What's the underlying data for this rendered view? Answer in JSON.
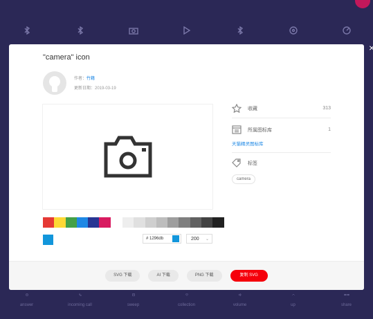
{
  "modal": {
    "title": "\"camera\" icon",
    "author_prefix": "作者：",
    "author_name": "竹籍",
    "updated_label": "更新日期：2019-03-19",
    "palette_colors": [
      "#e53935",
      "#fdd835",
      "#43a047",
      "#1e88e5",
      "#283593",
      "#d81b60"
    ],
    "gray_colors": [
      "#eeeeee",
      "#e0e0e0",
      "#cfcfcf",
      "#bdbdbd",
      "#9e9e9e",
      "#7f7f7f",
      "#616161",
      "#424242",
      "#212121"
    ],
    "selected_color": "#1296db",
    "hex_value": "# 1296db",
    "size_value": "200",
    "side": {
      "favorite_label": "收藏",
      "favorite_count": "313",
      "library_label": "所属图标库",
      "library_count": "1",
      "library_link": "天猫精灵图标库",
      "tags_label": "标签",
      "tag": "camera"
    },
    "buttons": {
      "svg_download": "SVG 下载",
      "ai_download": "AI 下载",
      "png_download": "PNG 下载",
      "copy_svg": "复制 SVG"
    }
  },
  "background": {
    "bottom_labels": [
      "answer",
      "incoming call",
      "sweep",
      "collection",
      "volume",
      "up",
      "share"
    ]
  }
}
